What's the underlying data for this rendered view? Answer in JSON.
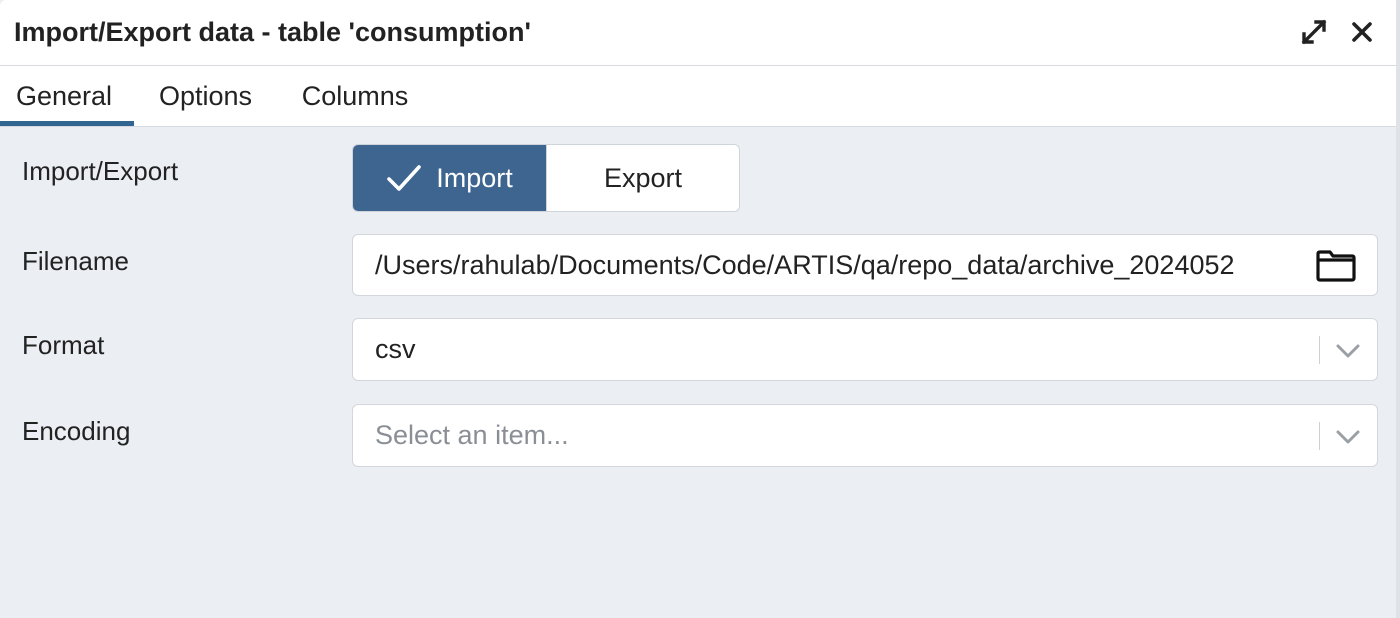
{
  "dialog": {
    "title": "Import/Export data - table 'consumption'"
  },
  "tabs": [
    {
      "label": "General",
      "active": true
    },
    {
      "label": "Options",
      "active": false
    },
    {
      "label": "Columns",
      "active": false
    }
  ],
  "form": {
    "import_export": {
      "label": "Import/Export",
      "options": [
        "Import",
        "Export"
      ],
      "selected": "Import"
    },
    "filename": {
      "label": "Filename",
      "value": "/Users/rahulab/Documents/Code/ARTIS/qa/repo_data/archive_2024052"
    },
    "format": {
      "label": "Format",
      "value": "csv"
    },
    "encoding": {
      "label": "Encoding",
      "placeholder": "Select an item..."
    }
  },
  "icons": {
    "maximize": "maximize-icon",
    "close": "close-icon",
    "check": "check-icon",
    "folder": "folder-icon",
    "chevron": "chevron-down-icon"
  },
  "colors": {
    "accent": "#3d6590",
    "tab_underline": "#326690",
    "background": "#ebeef3"
  }
}
